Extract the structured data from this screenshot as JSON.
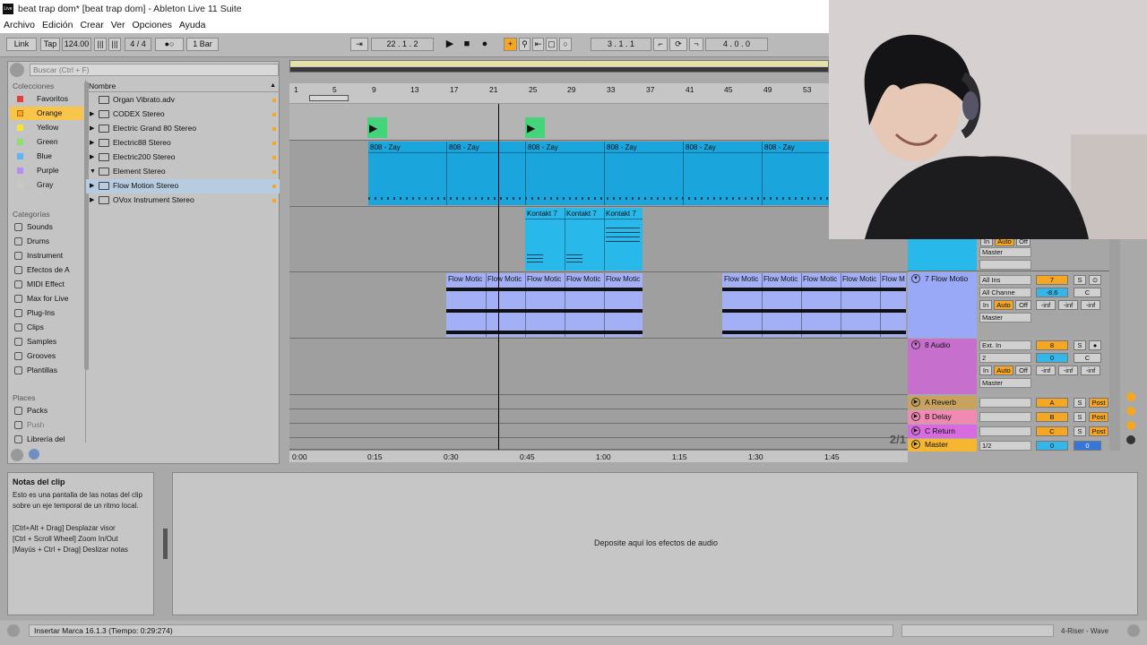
{
  "window": {
    "title": "beat trap dom*  [beat trap dom] - Ableton Live 11 Suite",
    "app_icon": "Live"
  },
  "menu": [
    "Archivo",
    "Edición",
    "Crear",
    "Ver",
    "Opciones",
    "Ayuda"
  ],
  "control_bar": {
    "link": "Link",
    "tap": "Tap",
    "tempo": "124.00",
    "signature": "4 / 4",
    "metronome": "●○",
    "quantize": "1 Bar",
    "arrangement_position": "22 .  1 .  2",
    "loop_start": "3 .  1 .  1",
    "loop_length": "4 .  0 .  0"
  },
  "browser": {
    "search_placeholder": "Buscar (Ctrl + F)",
    "collections_title": "Colecciones",
    "collections": [
      {
        "label": "Favoritos",
        "color": "#e0413c"
      },
      {
        "label": "Orange",
        "color": "#f5a623",
        "selected": true
      },
      {
        "label": "Yellow",
        "color": "#f3e438"
      },
      {
        "label": "Green",
        "color": "#8ee06a"
      },
      {
        "label": "Blue",
        "color": "#5db5f3"
      },
      {
        "label": "Purple",
        "color": "#b68ef0"
      },
      {
        "label": "Gray",
        "color": "#c8c8c8"
      }
    ],
    "categories_title": "Categorías",
    "categories": [
      "Sounds",
      "Drums",
      "Instrument",
      "Efectos de A",
      "MIDI Effect",
      "Max for Live",
      "Plug-Ins",
      "Clips",
      "Samples",
      "Grooves",
      "Plantillas"
    ],
    "places_title": "Places",
    "places": [
      "Packs",
      "Push",
      "Librería del"
    ],
    "list_header": "Nombre",
    "items": [
      {
        "label": "Organ Vibrato.adv",
        "arrow": ""
      },
      {
        "label": "CODEX Stereo",
        "arrow": "▶"
      },
      {
        "label": "Electric Grand 80 Stereo",
        "arrow": "▶"
      },
      {
        "label": "Electric88 Stereo",
        "arrow": "▶"
      },
      {
        "label": "Electric200 Stereo",
        "arrow": "▶"
      },
      {
        "label": "Element Stereo",
        "arrow": "▼"
      },
      {
        "label": "Flow Motion Stereo",
        "arrow": "▶",
        "selected": true
      },
      {
        "label": "OVox Instrument Stereo",
        "arrow": "▶"
      }
    ]
  },
  "arrangement": {
    "bar_numbers": [
      "1",
      "5",
      "9",
      "13",
      "17",
      "21",
      "25",
      "29",
      "33",
      "37",
      "41",
      "45",
      "49",
      "53"
    ],
    "time_labels": [
      "0:00",
      "0:15",
      "0:30",
      "0:45",
      "1:00",
      "1:15",
      "1:30",
      "1:45"
    ],
    "clip_808": "808 - Zay",
    "clip_kontakt": "Kontakt 7",
    "clip_flow": "Flow Motic",
    "clip_flow_last": "Flow M",
    "zoom_indicator": "2/1"
  },
  "mixer": {
    "tracks": [
      {
        "name": "7 Flow Motio",
        "color": "#9aa9f7",
        "input": "All Ins",
        "channel": "All Channe",
        "output": "Master",
        "number": "7",
        "volume": "-8.6",
        "pan": "C"
      },
      {
        "name": "8 Audio",
        "color": "#c66fcd",
        "input": "Ext. In",
        "channel": "2",
        "output": "Master",
        "number": "8",
        "volume": "0",
        "pan": "C"
      },
      {
        "name": "A Reverb",
        "color": "#c8a35e",
        "letter": "A"
      },
      {
        "name": "B Delay",
        "color": "#f08ab3",
        "letter": "B"
      },
      {
        "name": "C Return",
        "color": "#d86be0",
        "letter": "C"
      },
      {
        "name": "Master",
        "color": "#f5b731",
        "output": "1/2",
        "volume": "0"
      }
    ],
    "upper_output": "Master",
    "labels": {
      "in": "In",
      "auto": "Auto",
      "off": "Off",
      "inf": "-inf",
      "solo": "S",
      "post": "Post"
    }
  },
  "detail": {
    "info_title": "Notas del clip",
    "info_body": "Esto es una pantalla de las notas del clip sobre un eje temporal de un ritmo local.\n\n[Ctrl+Alt + Drag] Desplazar visor\n[Ctrl + Scroll Wheel] Zoom In/Out\n[Mayús + Ctrl + Drag] Deslizar notas",
    "device_hint": "Deposite aquí los efectos de audio"
  },
  "status": {
    "text": "Insertar Marca 16.1.3 (Tiempo: 0:29:274)",
    "track": "4-Riser - Wave"
  },
  "colors": {
    "clip_blue": "#1aa5dc",
    "clip_kontakt": "#29b8ea",
    "clip_flow": "#a3b0f6",
    "clip_green": "#45d47a",
    "accent_orange": "#f5a623"
  }
}
